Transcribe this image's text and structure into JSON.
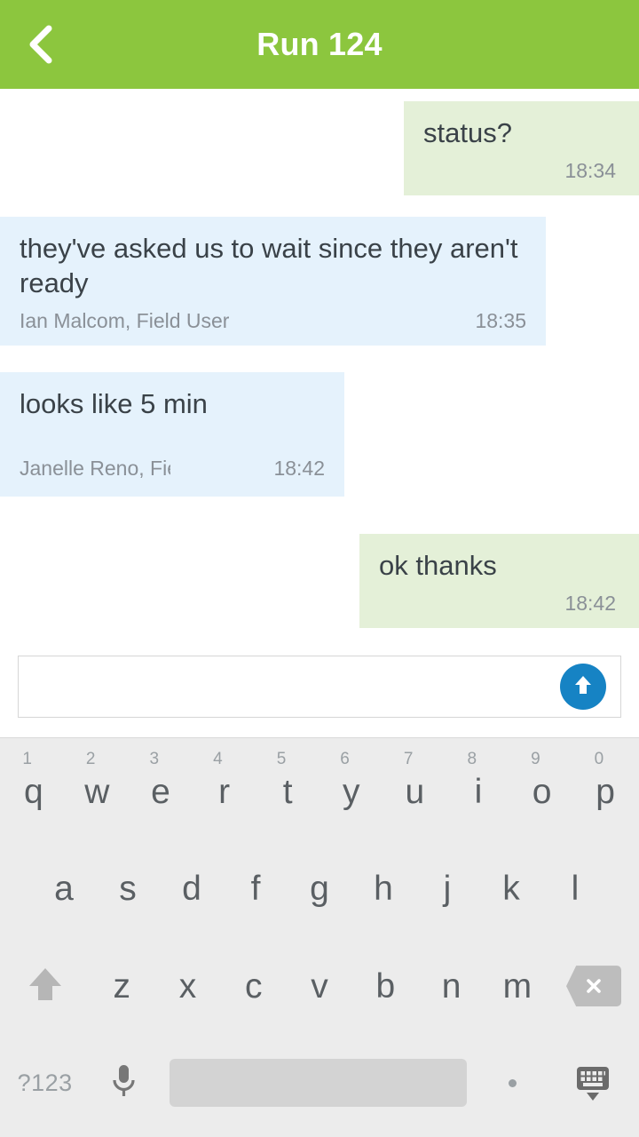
{
  "header": {
    "title": "Run 124",
    "back_icon": "chevron-left-icon",
    "bg_color": "#8CC63E",
    "title_color": "#FFFFFF"
  },
  "colors": {
    "outgoing_bubble": "#E4F0D8",
    "incoming_bubble": "#E5F2FC",
    "text": "#3A4248",
    "meta_text": "#8A9097",
    "send_button": "#1683C4",
    "keyboard_bg": "#ECECEC",
    "key_text": "#5A5F63"
  },
  "conversation": {
    "messages": [
      {
        "direction": "out",
        "text": "status?",
        "sender": "",
        "time": "18:34"
      },
      {
        "direction": "in",
        "text": "they've asked us to wait since they aren't ready",
        "sender": "Ian Malcom, Field User",
        "time": "18:35"
      },
      {
        "direction": "in",
        "text": "looks like 5 min",
        "sender": "Janelle Reno, Field User",
        "time": "18:42"
      },
      {
        "direction": "out",
        "text": "ok thanks",
        "sender": "",
        "time": "18:42"
      }
    ]
  },
  "composer": {
    "value": "",
    "placeholder": "",
    "send_icon": "send-arrow-up-icon"
  },
  "keyboard": {
    "row1": [
      {
        "letter": "q",
        "num": "1"
      },
      {
        "letter": "w",
        "num": "2"
      },
      {
        "letter": "e",
        "num": "3"
      },
      {
        "letter": "r",
        "num": "4"
      },
      {
        "letter": "t",
        "num": "5"
      },
      {
        "letter": "y",
        "num": "6"
      },
      {
        "letter": "u",
        "num": "7"
      },
      {
        "letter": "i",
        "num": "8"
      },
      {
        "letter": "o",
        "num": "9"
      },
      {
        "letter": "p",
        "num": "0"
      }
    ],
    "row2": [
      {
        "letter": "a"
      },
      {
        "letter": "s"
      },
      {
        "letter": "d"
      },
      {
        "letter": "f"
      },
      {
        "letter": "g"
      },
      {
        "letter": "h"
      },
      {
        "letter": "j"
      },
      {
        "letter": "k"
      },
      {
        "letter": "l"
      }
    ],
    "row3": [
      {
        "letter": "z"
      },
      {
        "letter": "x"
      },
      {
        "letter": "c"
      },
      {
        "letter": "v"
      },
      {
        "letter": "b"
      },
      {
        "letter": "n"
      },
      {
        "letter": "m"
      }
    ],
    "shift_icon": "shift-arrow-up-icon",
    "backspace_icon": "backspace-icon",
    "symbols_label": "?123",
    "mic_icon": "microphone-icon",
    "space_label": "",
    "period_label": ".",
    "hide_keyboard_icon": "hide-keyboard-icon"
  }
}
